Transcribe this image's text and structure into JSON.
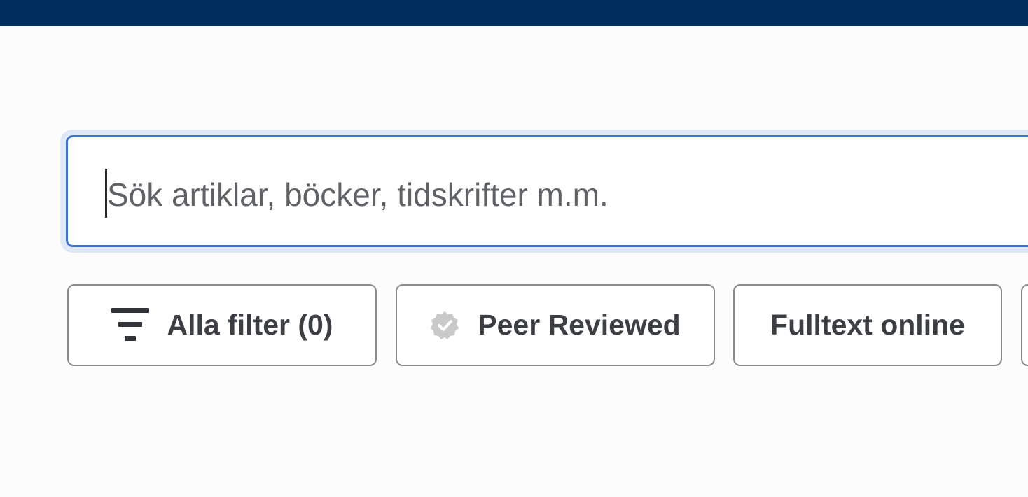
{
  "search": {
    "placeholder": "Sök artiklar, böcker, tidskrifter m.m.",
    "value": ""
  },
  "filters": {
    "all_filters_label": "Alla filter (0)",
    "peer_reviewed_label": "Peer Reviewed",
    "fulltext_online_label": "Fulltext online"
  },
  "icons": {
    "filter": "filter-icon",
    "peer_reviewed": "check-badge-icon"
  },
  "colors": {
    "header": "#002e5f",
    "focus_border": "#3f74d1",
    "focus_ring": "#dfe8f7",
    "chip_border": "#8b8b8b",
    "chip_text": "#3b3f44"
  }
}
